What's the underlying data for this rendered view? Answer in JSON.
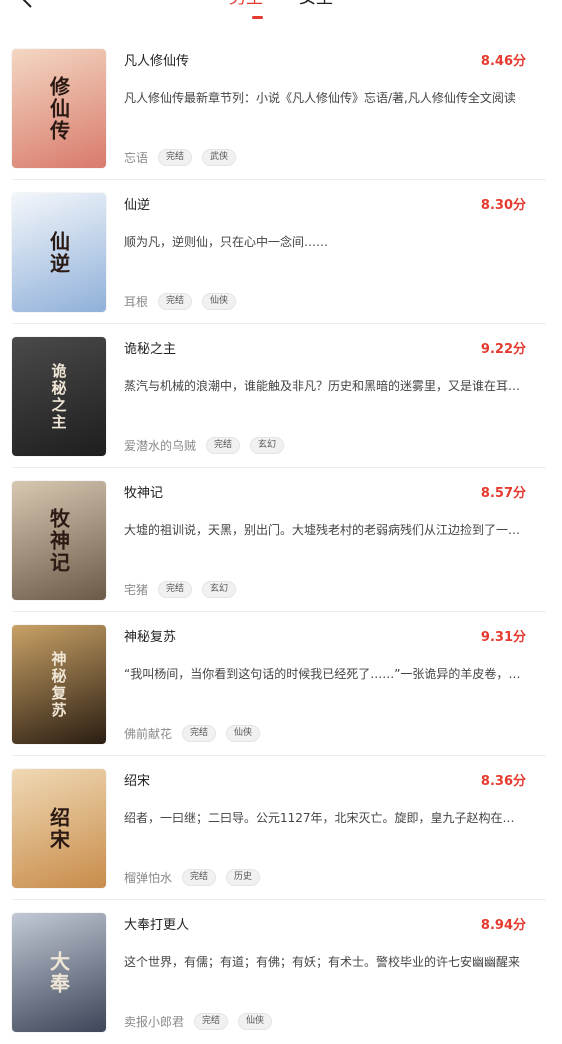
{
  "header": {
    "tabs": [
      {
        "label": "男生",
        "active": true
      },
      {
        "label": "女生",
        "active": false
      }
    ]
  },
  "books": [
    {
      "title": "凡人修仙传",
      "score": "8.46分",
      "intro": "凡人修仙传最新章节列：小说《凡人修仙传》忘语/著,凡人修仙传全文阅读",
      "author": "忘语",
      "tags": [
        "完结",
        "武侠"
      ],
      "cover_text": "修仙传",
      "cover_colors": [
        "#f3d7c2",
        "#d97a6c"
      ]
    },
    {
      "title": "仙逆",
      "score": "8.30分",
      "intro": "顺为凡，逆则仙，只在心中一念间……",
      "author": "耳根",
      "tags": [
        "完结",
        "仙侠"
      ],
      "cover_text": "仙逆",
      "cover_colors": [
        "#f4f7fb",
        "#8fb0d9"
      ]
    },
    {
      "title": "诡秘之主",
      "score": "9.22分",
      "intro": "蒸汽与机械的浪潮中，谁能触及非凡？历史和黑暗的迷雾里，又是谁在耳语？",
      "author": "爱潜水的乌贼",
      "tags": [
        "完结",
        "玄幻"
      ],
      "cover_text": "诡秘之主",
      "cover_colors": [
        "#4a4a4a",
        "#1e1e1e"
      ]
    },
    {
      "title": "牧神记",
      "score": "8.57分",
      "intro": "大墟的祖训说，天黑，别出门。大墟残老村的老弱病残们从江边捡到了一个婴儿",
      "author": "宅猪",
      "tags": [
        "完结",
        "玄幻"
      ],
      "cover_text": "牧神记",
      "cover_colors": [
        "#d8c8b2",
        "#6b5a48"
      ]
    },
    {
      "title": "神秘复苏",
      "score": "9.31分",
      "intro": "“我叫杨间，当你看到这句话的时候我已经死了……”一张诡异的羊皮卷，一个恐怖的故事",
      "author": "佛前献花",
      "tags": [
        "完结",
        "仙侠"
      ],
      "cover_text": "神秘复苏",
      "cover_colors": [
        "#c9a266",
        "#2a1d12"
      ]
    },
    {
      "title": "绍宋",
      "score": "8.36分",
      "intro": "绍者，一曰继；二曰导。公元1127年，北宋灭亡。旋即，皇九子赵构在河南应天府",
      "author": "榴弹怕水",
      "tags": [
        "完结",
        "历史"
      ],
      "cover_text": "绍宋",
      "cover_colors": [
        "#f0d9b5",
        "#c88c4a"
      ]
    },
    {
      "title": "大奉打更人",
      "score": "8.94分",
      "intro": "这个世界，有儒；有道；有佛；有妖；有术士。警校毕业的许七安幽幽醒来",
      "author": "卖报小郎君",
      "tags": [
        "完结",
        "仙侠"
      ],
      "cover_text": "大奉",
      "cover_colors": [
        "#c2c9d6",
        "#3c4658"
      ]
    }
  ]
}
